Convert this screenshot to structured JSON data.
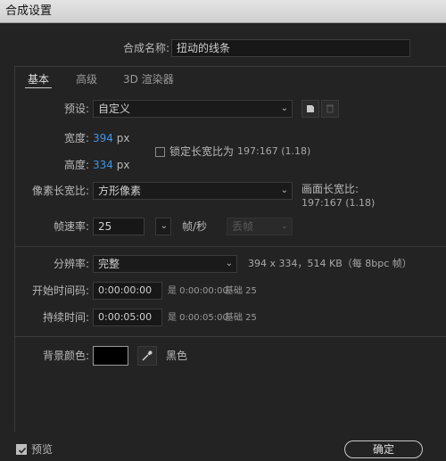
{
  "window": {
    "title": "合成设置"
  },
  "comp_name": {
    "label": "合成名称:",
    "value": "扭动的线条"
  },
  "tabs": [
    {
      "label": "基本"
    },
    {
      "label": "高级"
    },
    {
      "label": "3D 渲染器"
    }
  ],
  "preset": {
    "label": "预设:",
    "value": "自定义"
  },
  "width": {
    "label": "宽度:",
    "value": "394",
    "unit": "px"
  },
  "height": {
    "label": "高度:",
    "value": "334",
    "unit": "px"
  },
  "lock_aspect": {
    "label": "锁定长宽比为",
    "value": "197:167 (1.18)",
    "checked": false
  },
  "pixel_aspect": {
    "label": "像素长宽比:",
    "value": "方形像素"
  },
  "frame_aspect": {
    "label": "画面长宽比:",
    "value": "197:167 (1.18)"
  },
  "frame_rate": {
    "label": "帧速率:",
    "value": "25",
    "unit": "帧/秒",
    "drop_frame": "丢帧"
  },
  "resolution": {
    "label": "分辨率:",
    "value": "完整",
    "info": "394 x 334，514 KB（每 8bpc 帧）"
  },
  "start_timecode": {
    "label": "开始时间码:",
    "value": "0:00:00:00",
    "note": "是 0:00:00:00",
    "base": "基础 25"
  },
  "duration": {
    "label": "持续时间:",
    "value": "0:00:05:00",
    "note": "是 0:00:05:00",
    "base": "基础 25"
  },
  "background_color": {
    "label": "背景颜色:",
    "name": "黑色",
    "color": "#000000"
  },
  "preview": {
    "label": "预览",
    "checked": true
  },
  "ok_button": {
    "label": "确定"
  }
}
